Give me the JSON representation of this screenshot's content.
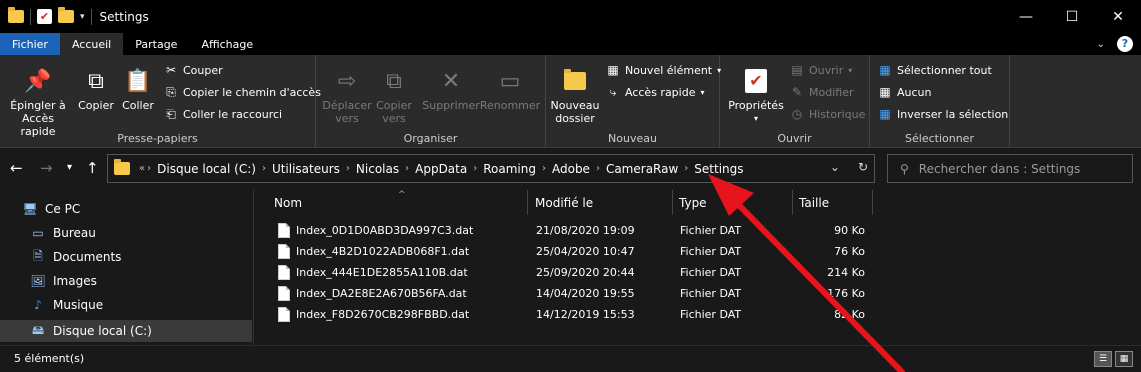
{
  "window": {
    "title": "Settings",
    "minimize": "—",
    "maximize": "☐",
    "close": "✕"
  },
  "tabs": [
    "Fichier",
    "Accueil",
    "Partage",
    "Affichage"
  ],
  "ribbon": {
    "presse_papiers": {
      "label": "Presse-papiers",
      "epingler": "Épingler à\nAccès rapide",
      "copier": "Copier",
      "coller": "Coller",
      "couper": "Couper",
      "copier_chemin": "Copier le chemin d'accès",
      "coller_raccourci": "Coller le raccourci"
    },
    "organiser": {
      "label": "Organiser",
      "deplacer": "Déplacer\nvers",
      "copier_vers": "Copier\nvers",
      "supprimer": "Supprimer",
      "renommer": "Renommer"
    },
    "nouveau": {
      "label": "Nouveau",
      "nouveau_dossier": "Nouveau\ndossier",
      "nouvel_element": "Nouvel élément",
      "acces_rapide": "Accès rapide"
    },
    "ouvrir": {
      "label": "Ouvrir",
      "proprietes": "Propriétés",
      "ouvrir": "Ouvrir",
      "modifier": "Modifier",
      "historique": "Historique"
    },
    "selectionner": {
      "label": "Sélectionner",
      "tout": "Sélectionner tout",
      "aucun": "Aucun",
      "inverser": "Inverser la sélection"
    }
  },
  "address": {
    "crumbs": [
      "Disque local (C:)",
      "Utilisateurs",
      "Nicolas",
      "AppData",
      "Roaming",
      "Adobe",
      "CameraRaw",
      "Settings"
    ],
    "overflow": "«"
  },
  "search": {
    "placeholder": "Rechercher dans : Settings"
  },
  "navpane": {
    "items": [
      {
        "label": "Ce PC",
        "icon": "computer-icon"
      },
      {
        "label": "Bureau",
        "icon": "desktop-icon"
      },
      {
        "label": "Documents",
        "icon": "documents-icon"
      },
      {
        "label": "Images",
        "icon": "images-icon"
      },
      {
        "label": "Musique",
        "icon": "music-icon"
      },
      {
        "label": "Disque local (C:)",
        "icon": "drive-icon"
      }
    ]
  },
  "columns": {
    "nom": "Nom",
    "modifie": "Modifié le",
    "type": "Type",
    "taille": "Taille"
  },
  "files": [
    {
      "name": "Index_0D1D0ABD3DA997C3.dat",
      "modified": "21/08/2020 19:09",
      "type": "Fichier DAT",
      "size": "90 Ko"
    },
    {
      "name": "Index_4B2D1022ADB068F1.dat",
      "modified": "25/04/2020 10:47",
      "type": "Fichier DAT",
      "size": "76 Ko"
    },
    {
      "name": "Index_444E1DE2855A110B.dat",
      "modified": "25/09/2020 20:44",
      "type": "Fichier DAT",
      "size": "214 Ko"
    },
    {
      "name": "Index_DA2E8E2A670B56FA.dat",
      "modified": "14/04/2020 19:55",
      "type": "Fichier DAT",
      "size": "176 Ko"
    },
    {
      "name": "Index_F8D2670CB298FBBD.dat",
      "modified": "14/12/2019 15:53",
      "type": "Fichier DAT",
      "size": "82 Ko"
    }
  ],
  "status": {
    "count": "5 élément(s)"
  },
  "colors": {
    "accent": "#1a63b8",
    "annotation": "#e8141b"
  }
}
